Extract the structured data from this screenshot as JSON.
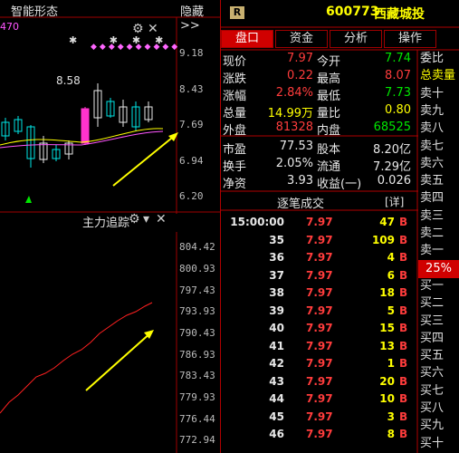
{
  "top_panel": {
    "title": "智能形态",
    "hide_label": "隐藏>>",
    "stock_tag": "R",
    "stock_code": "600773",
    "stock_name": "西藏城投",
    "partial_number": "470",
    "price_marker": "8.58",
    "y_ticks": [
      "9.18",
      "8.43",
      "7.69",
      "6.94",
      "6.20"
    ]
  },
  "bottom_panel": {
    "title": "主力追踪",
    "y_ticks": [
      "804.42",
      "800.93",
      "797.43",
      "793.93",
      "790.43",
      "786.93",
      "783.43",
      "779.93",
      "776.44",
      "772.94"
    ]
  },
  "tabs": [
    "盘口",
    "资金",
    "分析",
    "操作"
  ],
  "side_labels": [
    "委比",
    "总卖量",
    "卖十",
    "卖九",
    "卖八",
    "卖七",
    "卖六",
    "卖五",
    "卖四",
    "卖三",
    "卖二",
    "卖一",
    "25%",
    "买一",
    "买二",
    "买三",
    "买四",
    "买五",
    "买六",
    "买七",
    "买八",
    "买九",
    "买十"
  ],
  "quote": [
    {
      "l1": "现价",
      "v1": "7.97",
      "l2": "今开",
      "v2": "7.74"
    },
    {
      "l1": "涨跌",
      "v1": "0.22",
      "l2": "最高",
      "v2": "8.07"
    },
    {
      "l1": "涨幅",
      "v1": "2.84%",
      "l2": "最低",
      "v2": "7.73"
    },
    {
      "l1": "总量",
      "v1": "14.99万",
      "l2": "量比",
      "v2": "0.80"
    },
    {
      "l1": "外盘",
      "v1": "81328",
      "l2": "内盘",
      "v2": "68525"
    }
  ],
  "fundamentals": [
    {
      "l1": "市盈",
      "v1": "77.53",
      "l2": "股本",
      "v2": "8.20亿"
    },
    {
      "l1": "换手",
      "v1": "2.05%",
      "l2": "流通",
      "v2": "7.29亿"
    },
    {
      "l1": "净资",
      "v1": "3.93",
      "l2": "收益(一)",
      "v2": "0.026"
    }
  ],
  "trades_header": {
    "title": "逐笔成交",
    "detail": "[详]"
  },
  "trades": [
    {
      "time": "15:00:00",
      "price": "7.97",
      "vol": "47",
      "side": "B"
    },
    {
      "time": "35",
      "price": "7.97",
      "vol": "109",
      "side": "B"
    },
    {
      "time": "36",
      "price": "7.97",
      "vol": "4",
      "side": "B"
    },
    {
      "time": "37",
      "price": "7.97",
      "vol": "6",
      "side": "B"
    },
    {
      "time": "38",
      "price": "7.97",
      "vol": "18",
      "side": "B"
    },
    {
      "time": "39",
      "price": "7.97",
      "vol": "5",
      "side": "B"
    },
    {
      "time": "40",
      "price": "7.97",
      "vol": "15",
      "side": "B"
    },
    {
      "time": "41",
      "price": "7.97",
      "vol": "13",
      "side": "B"
    },
    {
      "time": "42",
      "price": "7.97",
      "vol": "1",
      "side": "B"
    },
    {
      "time": "43",
      "price": "7.97",
      "vol": "20",
      "side": "B"
    },
    {
      "time": "44",
      "price": "7.97",
      "vol": "10",
      "side": "B"
    },
    {
      "time": "45",
      "price": "7.97",
      "vol": "3",
      "side": "B"
    },
    {
      "time": "46",
      "price": "7.97",
      "vol": "8",
      "side": "B"
    }
  ],
  "colors": {
    "up": "#ff3c3c",
    "down": "#00e600",
    "label": "#e0e0e0",
    "accent": "#ffff00",
    "border": "#b00000"
  }
}
